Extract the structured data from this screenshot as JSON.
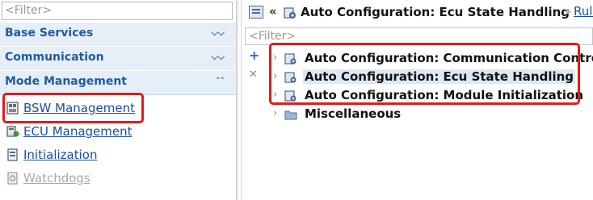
{
  "left_panel": {
    "filter_placeholder": "<Filter>",
    "sections": [
      {
        "label": "Base Services",
        "state": "collapsed"
      },
      {
        "label": "Communication",
        "state": "collapsed"
      },
      {
        "label": "Mode Management",
        "state": "expanded"
      }
    ],
    "items": [
      {
        "label": "BSW Management",
        "icon": "bsw-management-icon",
        "enabled": true
      },
      {
        "label": "ECU Management",
        "icon": "ecu-management-icon",
        "enabled": true
      },
      {
        "label": "Initialization",
        "icon": "initialization-icon",
        "enabled": true
      },
      {
        "label": "Watchdogs",
        "icon": "watchdog-icon",
        "enabled": false
      }
    ]
  },
  "right_panel": {
    "header": {
      "back_glyph": "«",
      "title": "Auto Configuration: Ecu State Handling",
      "separator": "▸",
      "link": "Rules,"
    },
    "filter_placeholder": "<Filter>",
    "tools": [
      {
        "name": "add",
        "glyph": "+"
      },
      {
        "name": "remove",
        "glyph": "✕"
      }
    ],
    "tree": [
      {
        "label": "Auto Configuration: Communication Control",
        "icon": "auto-config-icon",
        "selected": false
      },
      {
        "label": "Auto Configuration: Ecu State Handling",
        "icon": "auto-config-icon",
        "selected": true
      },
      {
        "label": "Auto Configuration: Module Initialization",
        "icon": "auto-config-icon",
        "selected": false
      },
      {
        "label": "Miscellaneous",
        "icon": "folder-icon",
        "selected": false
      }
    ]
  },
  "colors": {
    "section_bg": "#e6eef8",
    "section_text": "#1e5c9f",
    "link": "#1a4fa8",
    "highlight": "#e21b1b",
    "selection": "#dbe8f6"
  }
}
